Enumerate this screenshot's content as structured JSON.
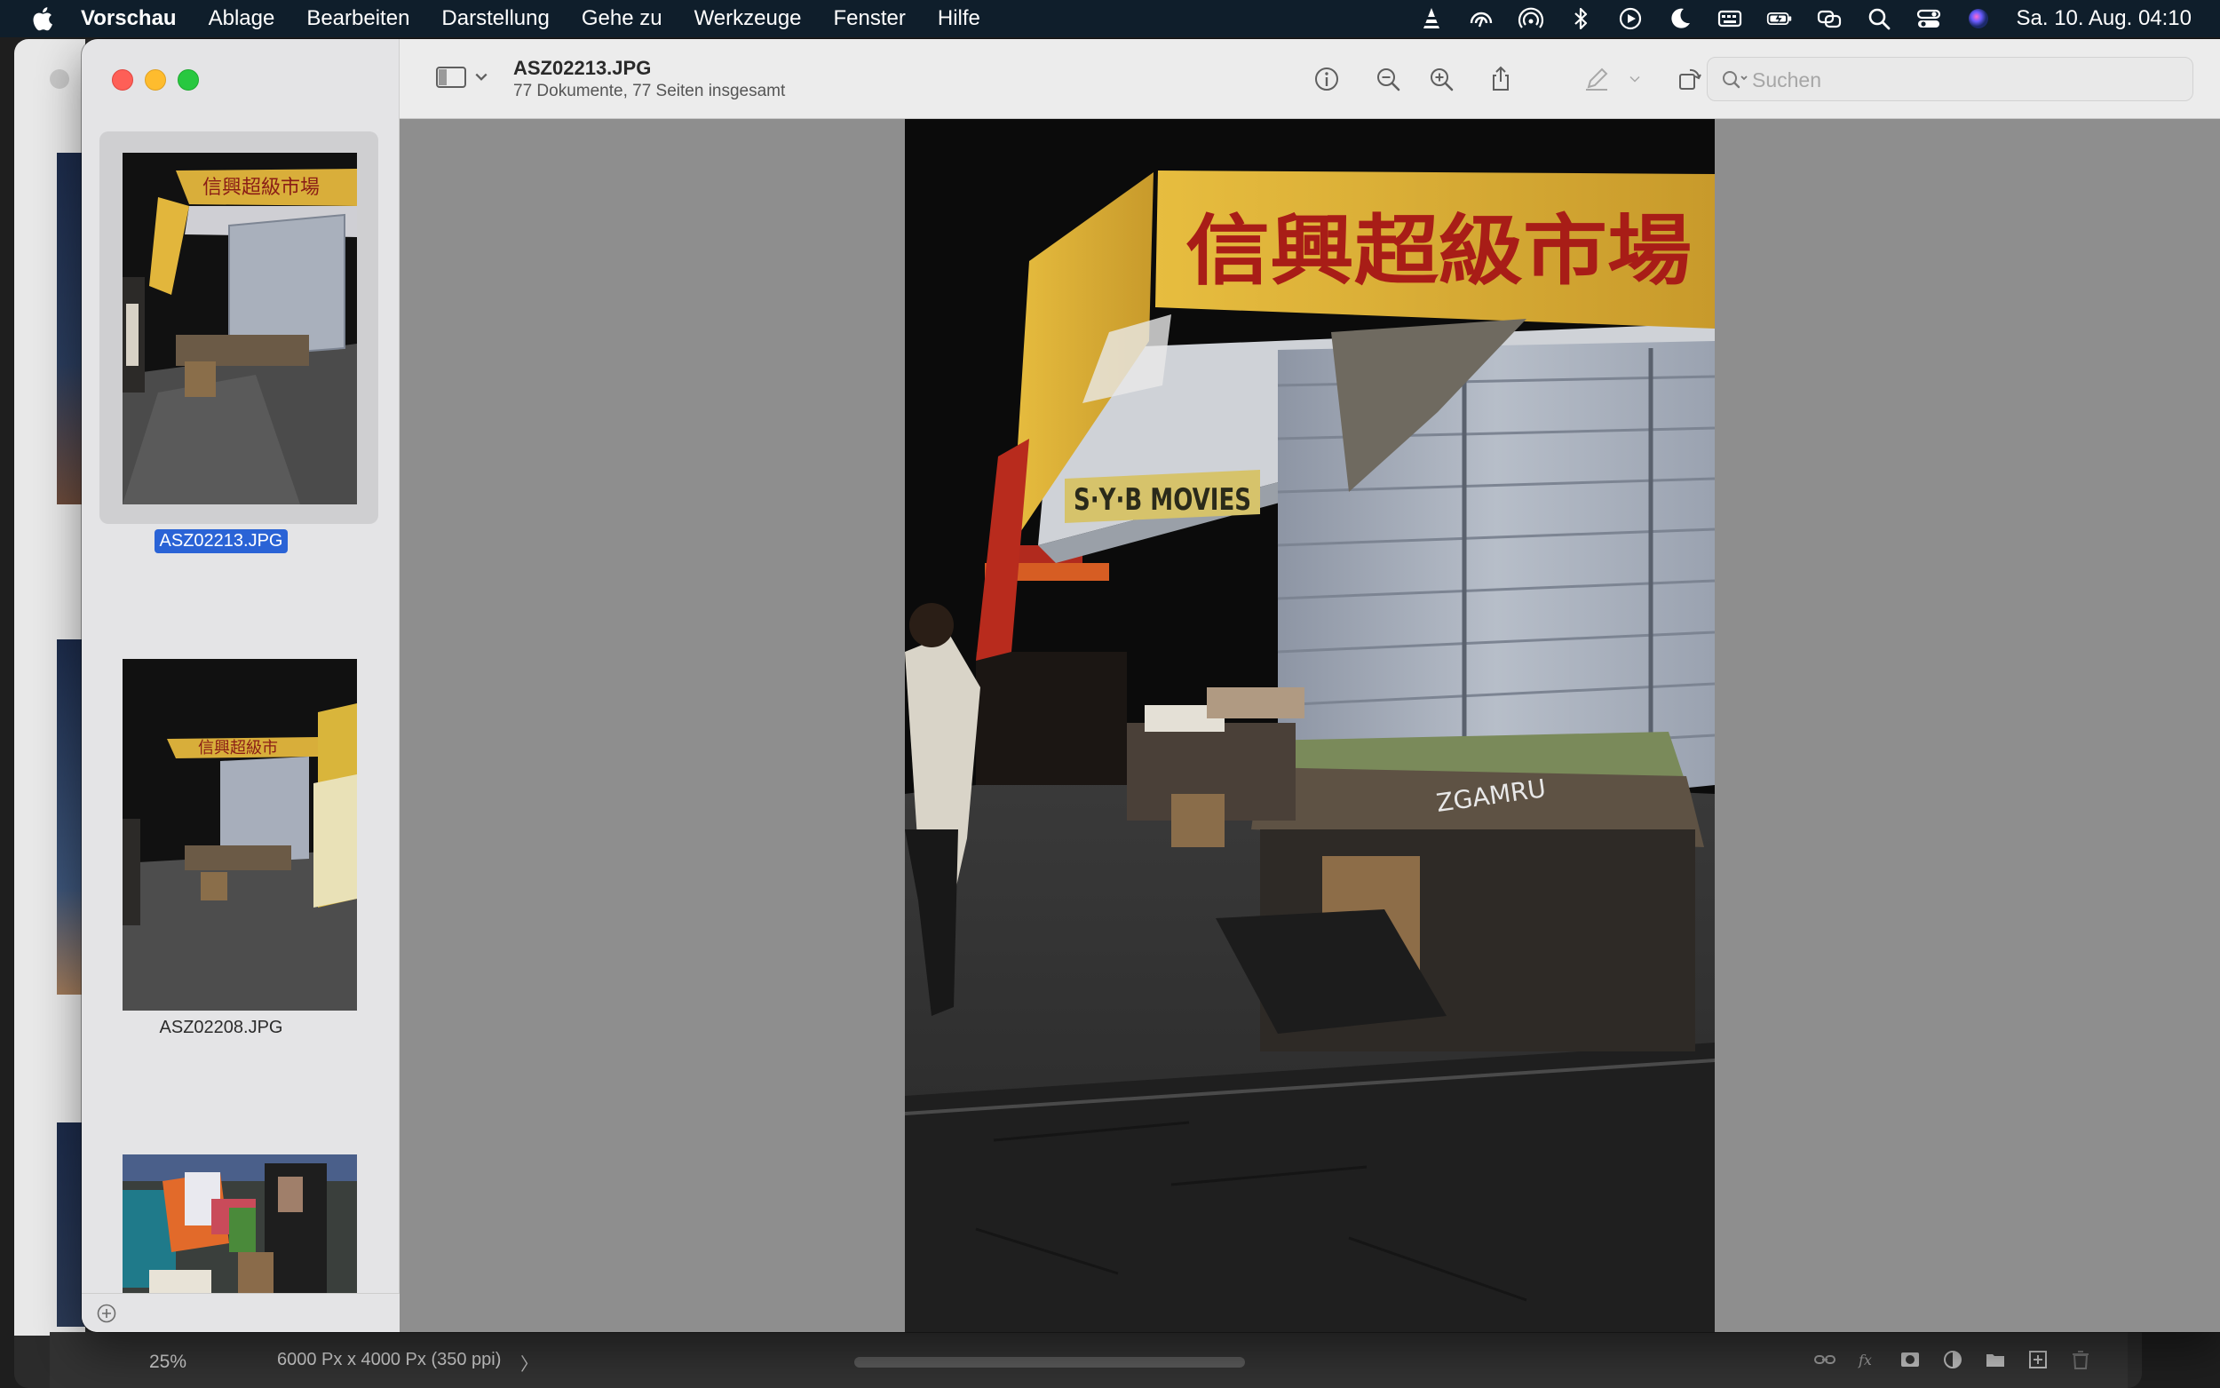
{
  "menubar": {
    "app_name": "Vorschau",
    "items": [
      "Ablage",
      "Bearbeiten",
      "Darstellung",
      "Gehe zu",
      "Werkzeuge",
      "Fenster",
      "Hilfe"
    ],
    "status_icons": [
      "vlc-icon",
      "wifi-calling-icon",
      "airdrop-icon",
      "bluetooth-icon",
      "play-icon",
      "moon-icon",
      "keyboard-icon",
      "battery-icon",
      "screen-mirroring-icon",
      "search-icon",
      "control-center-icon",
      "siri-icon"
    ],
    "clock": "Sa. 10. Aug. 04:10"
  },
  "window": {
    "title": "ASZ02213.JPG",
    "subtitle": "77 Dokumente, 77 Seiten insgesamt"
  },
  "search": {
    "placeholder": "Suchen",
    "value": ""
  },
  "toolbar_icons": [
    "info-icon",
    "zoom-out-icon",
    "zoom-in-icon",
    "share-icon",
    "markup-pen-icon",
    "chevron-down-icon",
    "rotate-icon",
    "annotate-icon"
  ],
  "thumbnails": [
    {
      "label": "ASZ02213.JPG",
      "selected": true
    },
    {
      "label": "ASZ02208.JPG",
      "selected": false
    },
    {
      "label": "",
      "selected": false
    }
  ],
  "photo": {
    "sign_text": "信興超級市場",
    "banner_text": "S·Y·B MOVIES",
    "graffiti_text": "ZGAMRU"
  },
  "background_window": {
    "zoom": "25%",
    "dimensions": "6000 Px x 4000 Px (350 ppi)",
    "arrow": "〉"
  },
  "colors": {
    "menubar_bg": "#0f1e2b",
    "selection_blue": "#2a63d6",
    "window_gray": "#8e8e8e",
    "sidebar_bg": "#e4e4e6",
    "sign_yellow": "#e0b73d",
    "sign_red": "#b3211b"
  }
}
